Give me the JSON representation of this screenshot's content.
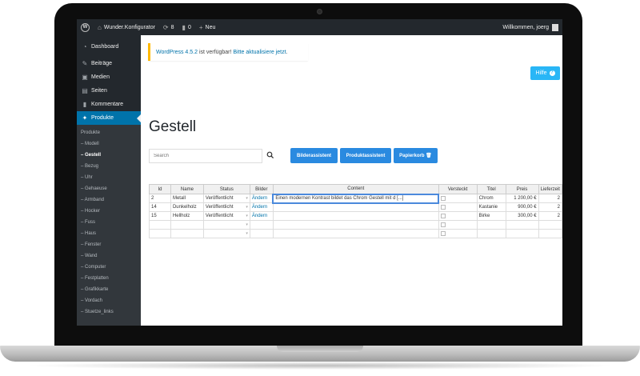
{
  "adminbar": {
    "site_name": "Wunder.Konfigurator",
    "updates_count": "8",
    "comments_count": "0",
    "new_label": "Neu",
    "greeting": "Willkommen, joerg"
  },
  "sidebar": {
    "menu": [
      {
        "label": "Dashboard",
        "icon": "dashboard-icon"
      },
      {
        "label": "Beiträge",
        "icon": "pin-icon"
      },
      {
        "label": "Medien",
        "icon": "media-icon"
      },
      {
        "label": "Seiten",
        "icon": "pages-icon"
      },
      {
        "label": "Kommentare",
        "icon": "comment-icon"
      },
      {
        "label": "Produkte",
        "icon": "products-icon"
      }
    ],
    "submenu": [
      "Produkte",
      "– Modell",
      "– Gestell",
      "– Bezug",
      "– Uhr",
      "– Gehaeuse",
      "– Armband",
      "– Hocker",
      "– Fuss",
      "– Haus",
      "– Fenster",
      "– Wand",
      "– Computer",
      "– Festplatten",
      "– Grafikkarte",
      "– Vordach",
      "– Stuetze_links"
    ]
  },
  "notice": {
    "version_text": "WordPress 4.5.2",
    "middle_text": " ist verfügbar! ",
    "link_text": "Bitte aktualisiere jetzt",
    "end_text": "."
  },
  "help_label": "Hilfe",
  "page_title": "Gestell",
  "search": {
    "placeholder": "Search"
  },
  "toolbar": {
    "bilder_label": "Bilderassistent",
    "produkt_label": "Produktassistent",
    "papierkorb_label": "Papierkorb 🗑"
  },
  "table": {
    "columns": [
      "Id",
      "Name",
      "Status",
      "Bilder",
      "Content",
      "Versteckt",
      "Titel",
      "Preis",
      "Lieferzeit"
    ],
    "rows": [
      {
        "id": "2",
        "name": "Metall",
        "status": "Veröffentlicht",
        "bilder": "Ändern",
        "content": "Einen modernen Kontrast bildet das Chrom Gestell mit d [...]",
        "titel": "Chrom",
        "preis": "1 200,00 €",
        "lieferzeit": "2"
      },
      {
        "id": "14",
        "name": "Dunkelholz",
        "status": "Veröffentlicht",
        "bilder": "Ändern",
        "content": "",
        "titel": "Kastanie",
        "preis": "900,00 €",
        "lieferzeit": "2"
      },
      {
        "id": "15",
        "name": "Hellholz",
        "status": "Veröffentlicht",
        "bilder": "Ändern",
        "content": "",
        "titel": "Birke",
        "preis": "300,00 €",
        "lieferzeit": "2"
      }
    ]
  },
  "colors": {
    "admin_dark": "#23282d",
    "accent_blue": "#0073aa",
    "button_blue": "#2a8ae0",
    "help_blue": "#29b6f6",
    "notice_yellow": "#ffb900"
  }
}
